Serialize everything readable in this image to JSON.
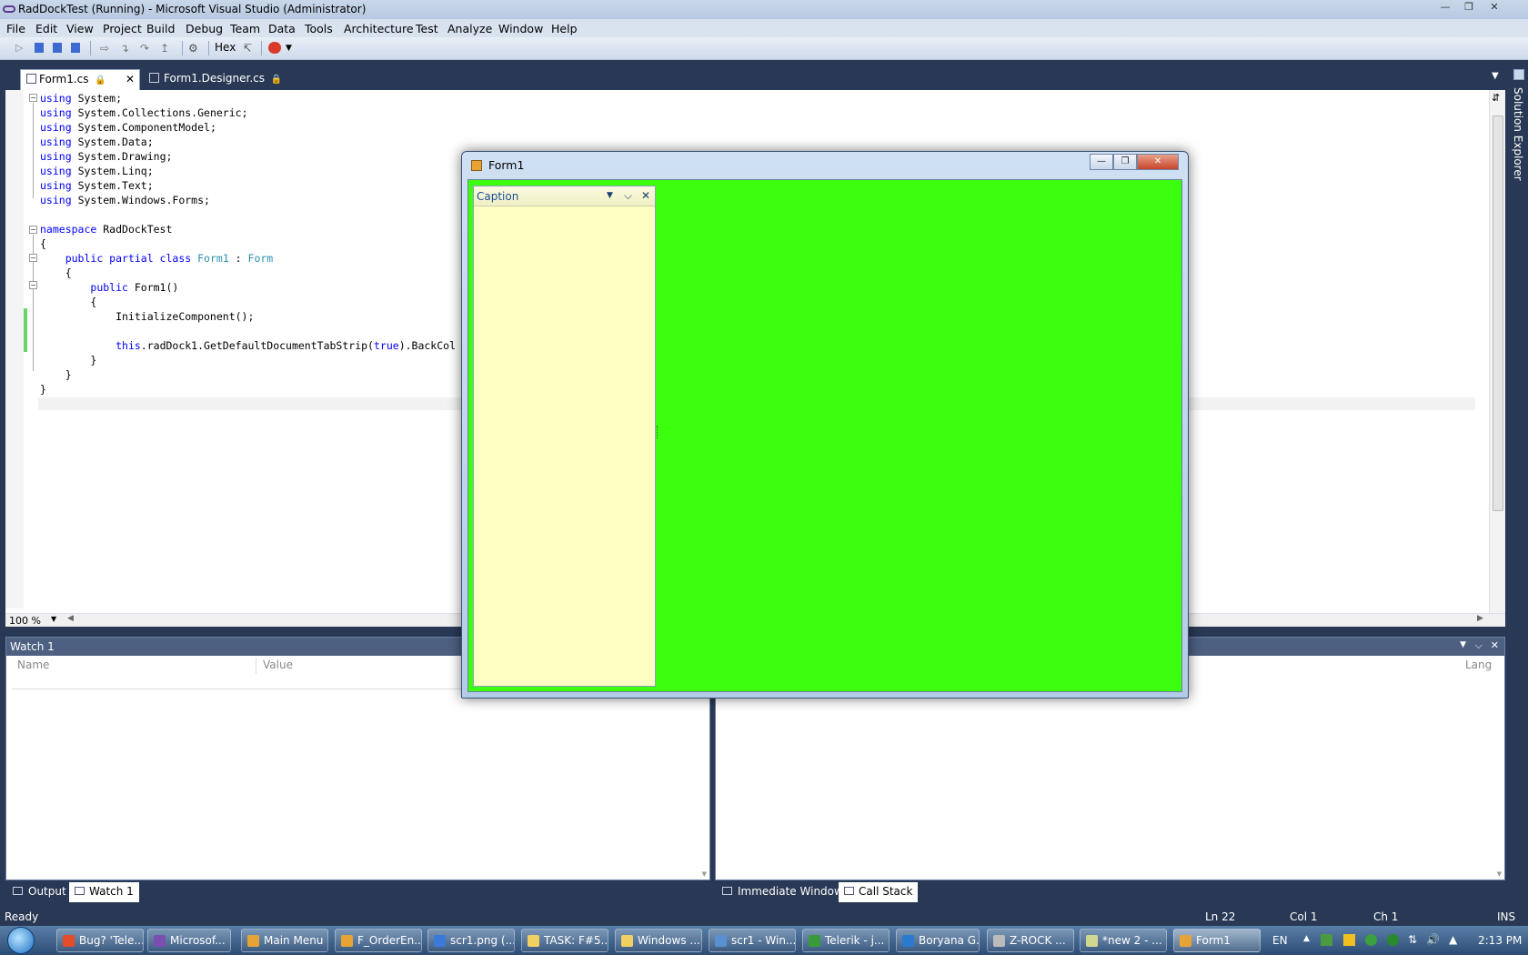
{
  "window": {
    "title": "RadDockTest (Running) - Microsoft Visual Studio (Administrator)"
  },
  "menu": [
    "File",
    "Edit",
    "View",
    "Project",
    "Build",
    "Debug",
    "Team",
    "Data",
    "Tools",
    "Architecture",
    "Test",
    "Analyze",
    "Window",
    "Help"
  ],
  "toolbar": {
    "hex_label": "Hex"
  },
  "tabs": [
    {
      "label": "Form1.cs",
      "active": true
    },
    {
      "label": "Form1.Designer.cs",
      "active": false
    }
  ],
  "editor": {
    "lines": [
      "using System;",
      "using System.Collections.Generic;",
      "using System.ComponentModel;",
      "using System.Data;",
      "using System.Drawing;",
      "using System.Linq;",
      "using System.Text;",
      "using System.Windows.Forms;",
      "",
      "namespace RadDockTest",
      "{",
      "    public partial class Form1 : Form",
      "    {",
      "        public Form1()",
      "        {",
      "            InitializeComponent();",
      "",
      "            this.radDock1.GetDefaultDocumentTabStrip(true).BackCol",
      "        }",
      "    }",
      "}"
    ],
    "zoom": "100 %"
  },
  "solution_explorer_label": "Solution Explorer",
  "watch": {
    "title": "Watch 1",
    "columns": [
      "Name",
      "Value"
    ]
  },
  "right_pane": {
    "columns": [
      "Lang"
    ]
  },
  "bottom_tabs_left": [
    "Output",
    "Watch 1"
  ],
  "bottom_tabs_right": [
    "Immediate Window",
    "Call Stack"
  ],
  "status": {
    "text": "Ready",
    "ln": "Ln 22",
    "col": "Col 1",
    "ch": "Ch 1",
    "mode": "INS"
  },
  "form1": {
    "title": "Form1",
    "tool_caption": "Caption",
    "client_color": "#3cff10",
    "tool_color": "#ffffc4"
  },
  "taskbar": {
    "items": [
      "Bug? 'Tele...",
      "Microsof...",
      "Main Menu",
      "F_OrderEn...",
      "scr1.png (...",
      "TASK: F#5...",
      "Windows ...",
      "scr1 - Win...",
      "Telerik - j...",
      "Boryana G...",
      "Z-ROCK ...",
      "*new 2 - ...",
      "Form1"
    ],
    "lang": "EN",
    "clock": "2:13 PM"
  }
}
